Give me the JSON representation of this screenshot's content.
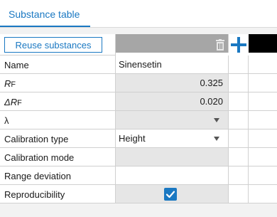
{
  "tab": {
    "label": "Substance table"
  },
  "header": {
    "reuse_button": "Reuse substances",
    "delete_icon": "trash-icon",
    "add_icon": "plus-icon"
  },
  "rows": [
    {
      "label": "Name",
      "value": "Sinensetin"
    },
    {
      "label_main": "R",
      "label_sub": "F",
      "value": "0.325"
    },
    {
      "label_main": "ΔR",
      "label_sub": "F",
      "value": "0.020"
    },
    {
      "label": "λ",
      "value": ""
    },
    {
      "label": "Calibration type",
      "value": "Height"
    },
    {
      "label": "Calibration mode",
      "value": ""
    },
    {
      "label": "Range deviation",
      "value": ""
    },
    {
      "label": "Reproducibility",
      "checked": true
    }
  ],
  "colors": {
    "accent": "#1a78c2",
    "header_col": "#a6a6a6",
    "input_grey": "#e6e6e6"
  }
}
